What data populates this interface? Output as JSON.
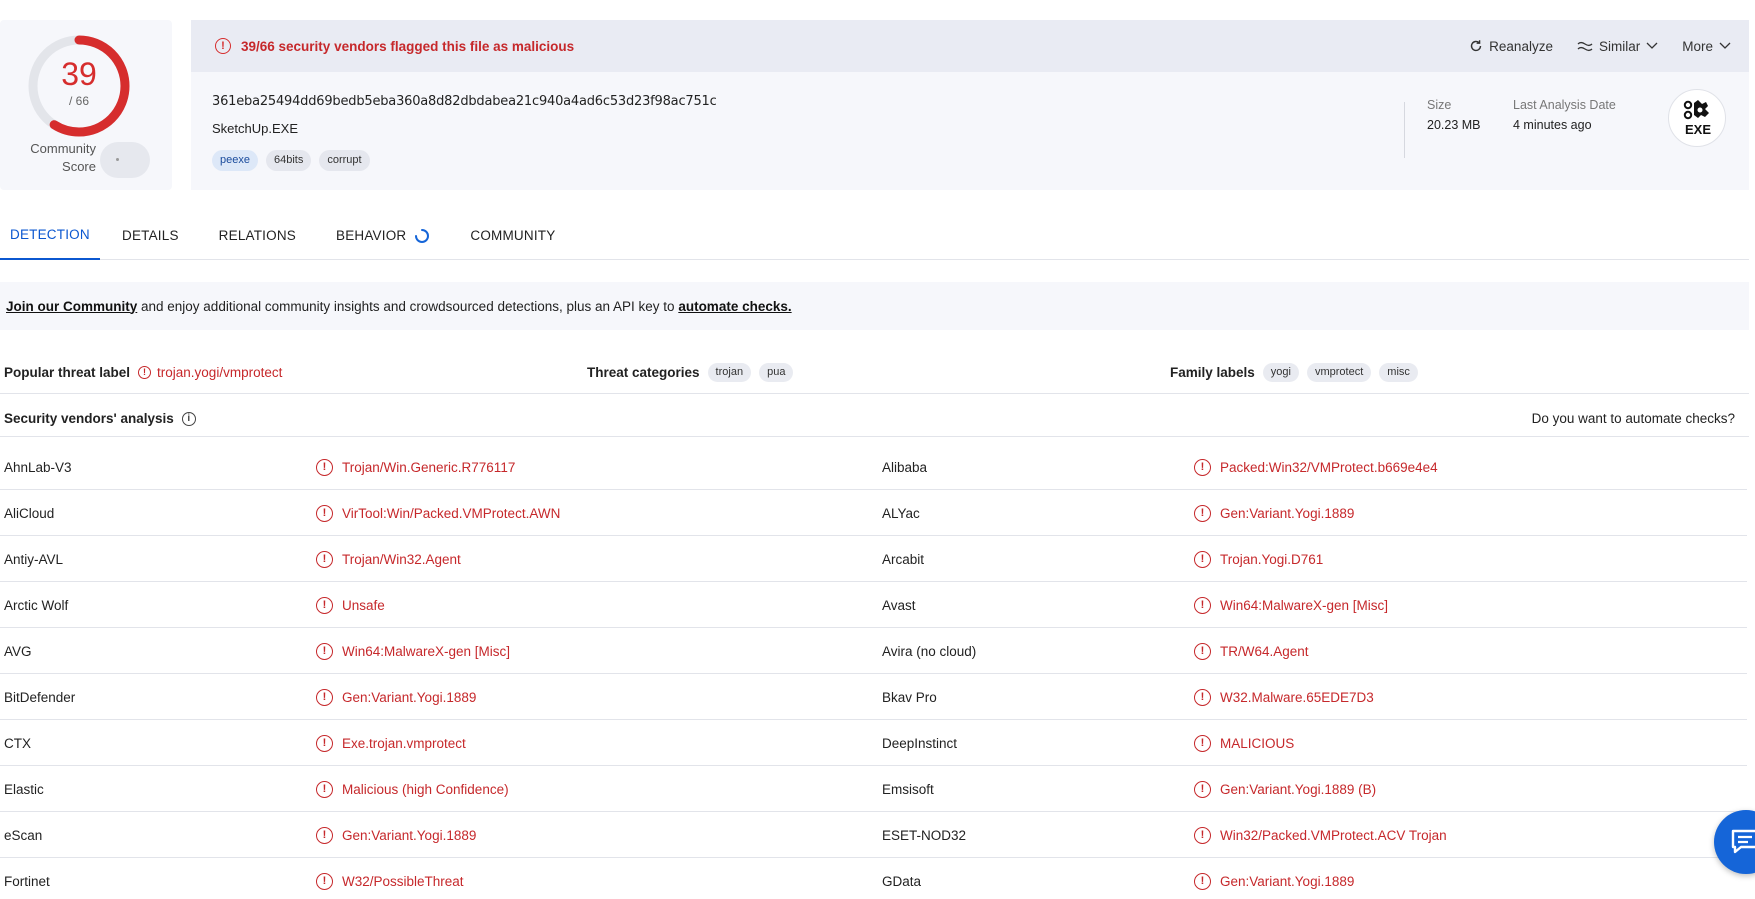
{
  "score": {
    "detections": "39",
    "total": "/ 66",
    "fraction": 0.59,
    "community_label": "Community\nScore",
    "color": "#d62d2d"
  },
  "alert": {
    "text": "39/66 security vendors flagged this file as malicious",
    "icon": "alert-circle-icon"
  },
  "actions": {
    "reanalyze": "Reanalyze",
    "similar": "Similar",
    "more": "More"
  },
  "file": {
    "hash": "361eba25494dd69bedb5eba360a8d82dbdabea21c940a4ad6c53d23f98ac751c",
    "name": "SketchUp.EXE",
    "tags": [
      "peexe",
      "64bits",
      "corrupt"
    ],
    "size_label": "Size",
    "size_value": "20.23 MB",
    "date_label": "Last Analysis Date",
    "date_value": "4 minutes ago",
    "type_badge": "EXE"
  },
  "tabs": [
    "DETECTION",
    "DETAILS",
    "RELATIONS",
    "BEHAVIOR",
    "COMMUNITY"
  ],
  "banner": {
    "join_link": "Join our Community",
    "middle": " and enjoy additional community insights and crowdsourced detections, plus an API key to ",
    "automate_link": "automate checks."
  },
  "threat": {
    "popular_label": "Popular threat label",
    "popular_value": "trojan.yogi/vmprotect",
    "categories_label": "Threat categories",
    "categories": [
      "trojan",
      "pua"
    ],
    "family_label": "Family labels",
    "families": [
      "yogi",
      "vmprotect",
      "misc"
    ]
  },
  "vendors_section": {
    "title": "Security vendors' analysis",
    "automate_question": "Do you want to automate checks?"
  },
  "vendors": [
    {
      "left_name": "AhnLab-V3",
      "left_result": "Trojan/Win.Generic.R776117",
      "right_name": "Alibaba",
      "right_result": "Packed:Win32/VMProtect.b669e4e4"
    },
    {
      "left_name": "AliCloud",
      "left_result": "VirTool:Win/Packed.VMProtect.AWN",
      "right_name": "ALYac",
      "right_result": "Gen:Variant.Yogi.1889"
    },
    {
      "left_name": "Antiy-AVL",
      "left_result": "Trojan/Win32.Agent",
      "right_name": "Arcabit",
      "right_result": "Trojan.Yogi.D761"
    },
    {
      "left_name": "Arctic Wolf",
      "left_result": "Unsafe",
      "right_name": "Avast",
      "right_result": "Win64:MalwareX-gen [Misc]"
    },
    {
      "left_name": "AVG",
      "left_result": "Win64:MalwareX-gen [Misc]",
      "right_name": "Avira (no cloud)",
      "right_result": "TR/W64.Agent"
    },
    {
      "left_name": "BitDefender",
      "left_result": "Gen:Variant.Yogi.1889",
      "right_name": "Bkav Pro",
      "right_result": "W32.Malware.65EDE7D3"
    },
    {
      "left_name": "CTX",
      "left_result": "Exe.trojan.vmprotect",
      "right_name": "DeepInstinct",
      "right_result": "MALICIOUS"
    },
    {
      "left_name": "Elastic",
      "left_result": "Malicious (high Confidence)",
      "right_name": "Emsisoft",
      "right_result": "Gen:Variant.Yogi.1889 (B)"
    },
    {
      "left_name": "eScan",
      "left_result": "Gen:Variant.Yogi.1889",
      "right_name": "ESET-NOD32",
      "right_result": "Win32/Packed.VMProtect.ACV Trojan"
    },
    {
      "left_name": "Fortinet",
      "left_result": "W32/PossibleThreat",
      "right_name": "GData",
      "right_result": "Gen:Variant.Yogi.1889"
    }
  ],
  "colors": {
    "malicious": "#c6282b",
    "accent": "#0b57d0",
    "panel_bg": "#f6f7fb"
  }
}
